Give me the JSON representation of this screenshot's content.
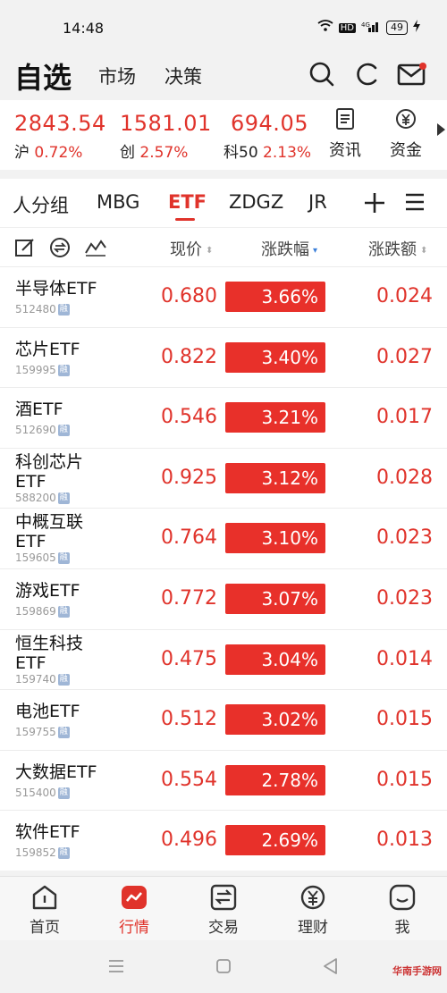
{
  "status": {
    "time": "14:48",
    "signal": "4G",
    "battery": "49"
  },
  "topnav": {
    "selected": "自选",
    "market": "市场",
    "strategy": "决策"
  },
  "indices": [
    {
      "value": "2843.54",
      "name": "沪",
      "pct": "0.72%"
    },
    {
      "value": "1581.01",
      "name": "创",
      "pct": "2.57%"
    },
    {
      "value": "694.05",
      "name": "科50",
      "pct": "2.13%"
    }
  ],
  "tools": {
    "news": "资讯",
    "funds": "资金"
  },
  "tabs": [
    "人分组",
    "MBG",
    "ETF",
    "ZDGZ",
    "JR"
  ],
  "active_tab": "ETF",
  "columns": {
    "price": "现价",
    "pct": "涨跌幅",
    "chg": "涨跌额"
  },
  "rows": [
    {
      "name": "半导体ETF",
      "code": "512480",
      "price": "0.680",
      "pct": "3.66%",
      "chg": "0.024"
    },
    {
      "name": "芯片ETF",
      "code": "159995",
      "price": "0.822",
      "pct": "3.40%",
      "chg": "0.027"
    },
    {
      "name": "酒ETF",
      "code": "512690",
      "price": "0.546",
      "pct": "3.21%",
      "chg": "0.017"
    },
    {
      "name": "科创芯片",
      "name2": "ETF",
      "code": "588200",
      "price": "0.925",
      "pct": "3.12%",
      "chg": "0.028"
    },
    {
      "name": "中概互联",
      "name2": "ETF",
      "code": "159605",
      "price": "0.764",
      "pct": "3.10%",
      "chg": "0.023"
    },
    {
      "name": "游戏ETF",
      "code": "159869",
      "price": "0.772",
      "pct": "3.07%",
      "chg": "0.023"
    },
    {
      "name": "恒生科技",
      "name2": "ETF",
      "code": "159740",
      "price": "0.475",
      "pct": "3.04%",
      "chg": "0.014"
    },
    {
      "name": "电池ETF",
      "code": "159755",
      "price": "0.512",
      "pct": "3.02%",
      "chg": "0.015"
    },
    {
      "name": "大数据ETF",
      "code": "515400",
      "price": "0.554",
      "pct": "2.78%",
      "chg": "0.015"
    },
    {
      "name": "软件ETF",
      "code": "159852",
      "price": "0.496",
      "pct": "2.69%",
      "chg": "0.013"
    }
  ],
  "rong_label": "融",
  "bottomnav": {
    "home": "首页",
    "market": "行情",
    "trade": "交易",
    "wealth": "理财",
    "me": "我"
  },
  "watermark": "华南手游网",
  "colors": {
    "up_red": "#e0332b",
    "accent": "#e0332b"
  }
}
